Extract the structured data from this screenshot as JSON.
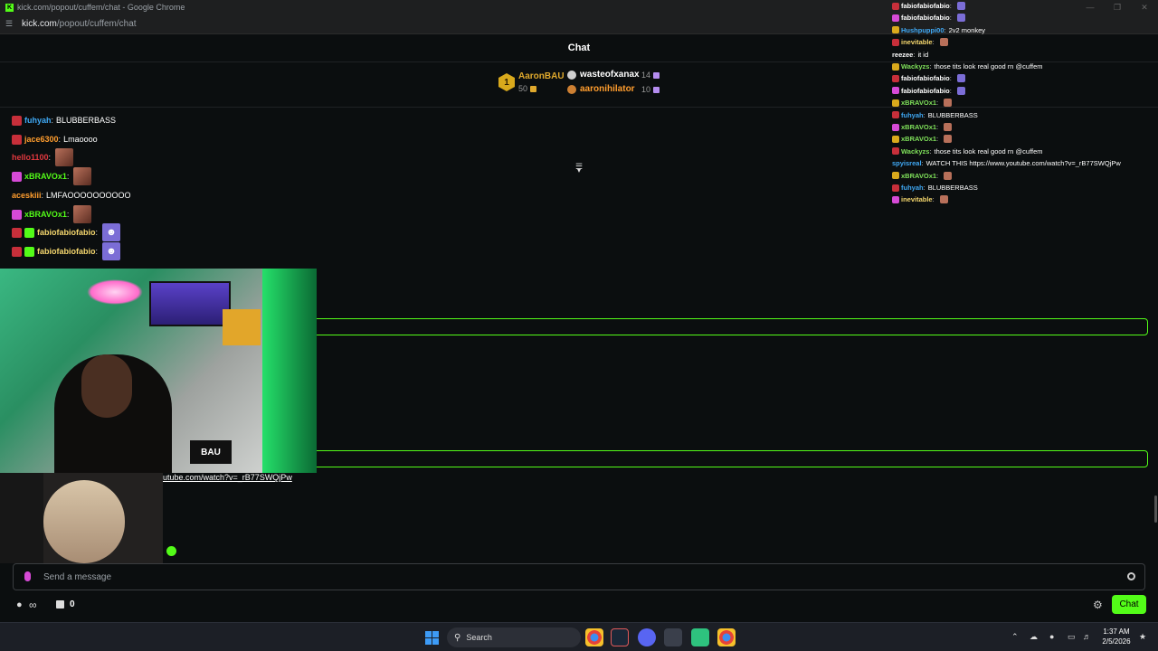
{
  "window": {
    "title": "kick.com/popout/cuffem/chat - Google Chrome"
  },
  "address": {
    "host": "kick.com",
    "path": "/popout/cuffem/chat"
  },
  "chat": {
    "header_title": "Chat"
  },
  "gifters": [
    {
      "rank": "1",
      "name": "AaronBAU",
      "count": "50"
    },
    {
      "name": "wasteofxanax",
      "count": "14"
    },
    {
      "name": "aaronihilator",
      "count": "10"
    }
  ],
  "messages": [
    {
      "user": "fuhyah",
      "text": "BLUBBERBASS",
      "user_color": "#3fa9f5"
    },
    {
      "user": "jace6300",
      "text": "Lmaoooo",
      "user_color": "#ff9d2e"
    },
    {
      "user": "hello1100",
      "text": "",
      "user_color": "#e0383e"
    },
    {
      "user": "xBRAVOx1",
      "text": "",
      "user_color": "#53fc18"
    },
    {
      "user": "aceskiii",
      "text": "LMFAOOOOOOOOOO",
      "user_color": "#ff9d2e"
    },
    {
      "user": "xBRAVOx1",
      "text": "",
      "user_color": "#53fc18"
    },
    {
      "user": "fabiofabiofabio",
      "text": "",
      "user_color": "#f5d76e"
    },
    {
      "user": "fabiofabiofabio",
      "text": "",
      "user_color": "#f5d76e"
    }
  ],
  "overlay_messages": [
    {
      "user": "fabiofabiofabio",
      "text": "",
      "user_color": "#ffffff"
    },
    {
      "user": "fabiofabiofabio",
      "text": "",
      "user_color": "#ffffff"
    },
    {
      "user": "Hushpuppi00",
      "text": "2v2 monkey",
      "user_color": "#3fa9f5"
    },
    {
      "user": "inevitable",
      "text": "",
      "user_color": "#f5d76e"
    },
    {
      "user": "reezee",
      "text": "it id",
      "user_color": "#ffffff"
    },
    {
      "user": "Wackyzs",
      "text": "those tits look real good rn @cuffem",
      "user_color": "#7fe05a"
    },
    {
      "user": "fabiofabiofabio",
      "text": "",
      "user_color": "#ffffff"
    },
    {
      "user": "fabiofabiofabio",
      "text": "",
      "user_color": "#ffffff"
    },
    {
      "user": "xBRAVOx1",
      "text": "",
      "user_color": "#7fe05a"
    },
    {
      "user": "fuhyah",
      "text": "BLUBBERBASS",
      "user_color": "#3fa9f5"
    },
    {
      "user": "xBRAVOx1",
      "text": "",
      "user_color": "#7fe05a"
    },
    {
      "user": "xBRAVOx1",
      "text": "",
      "user_color": "#7fe05a"
    },
    {
      "user": "Wackyzs",
      "text": "those tits look real good rn @cuffem",
      "user_color": "#7fe05a"
    },
    {
      "user": "spyisreal",
      "text": "WATCH THIS https://www.youtube.com/watch?v=_rB77SWQjPw",
      "user_color": "#3fa9f5"
    },
    {
      "user": "xBRAVOx1",
      "text": "",
      "user_color": "#7fe05a"
    },
    {
      "user": "fuhyah",
      "text": "BLUBBERBASS",
      "user_color": "#3fa9f5"
    },
    {
      "user": "inevitable",
      "text": "",
      "user_color": "#f5d76e"
    }
  ],
  "url_fragment": "utube.com/watch?v=_rB77SWQjPw",
  "composer": {
    "placeholder": "Send a message"
  },
  "footer": {
    "gift_count": "0",
    "chat_button": "Chat"
  },
  "taskbar": {
    "search_label": "Search",
    "time": "1:37 AM",
    "date": "2/5/2026"
  },
  "colors": {
    "accent": "#53fc18",
    "background": "#0b0e0f"
  }
}
